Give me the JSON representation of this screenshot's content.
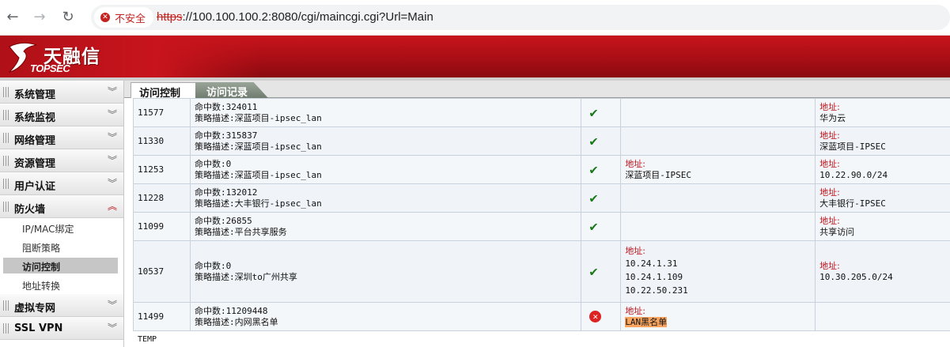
{
  "browser": {
    "security_label": "不安全",
    "url_proto": "https",
    "url_rest": "://100.100.100.2:8080/cgi/maincgi.cgi?Url=Main"
  },
  "brand": {
    "name_cn": "天融信",
    "name_en": "TOPSEC",
    "color": "#c8141c"
  },
  "sidebar": {
    "menus": [
      {
        "label": "系统管理",
        "expanded": false
      },
      {
        "label": "系统监视",
        "expanded": false
      },
      {
        "label": "网络管理",
        "expanded": false
      },
      {
        "label": "资源管理",
        "expanded": false
      },
      {
        "label": "用户认证",
        "expanded": false
      },
      {
        "label": "防火墙",
        "expanded": true
      },
      {
        "label": "虚拟专网",
        "expanded": false
      },
      {
        "label": "SSL VPN",
        "expanded": false
      }
    ],
    "firewall_items": [
      {
        "label": "IP/MAC绑定"
      },
      {
        "label": "阻断策略"
      },
      {
        "label": "访问控制",
        "active": true
      },
      {
        "label": "地址转换"
      }
    ]
  },
  "tabs": [
    {
      "label": "访问控制",
      "active": true
    },
    {
      "label": "访问记录",
      "active": false
    }
  ],
  "rows": [
    {
      "id": "11577",
      "hits": "命中数:324011",
      "desc": "策略描述:深蓝项目-ipsec_lan",
      "status": "enabled",
      "src_label": "",
      "src": [],
      "dst_label": "地址:",
      "dst": [
        "华为云"
      ]
    },
    {
      "id": "11330",
      "hits": "命中数:315837",
      "desc": "策略描述:深蓝项目-ipsec_lan",
      "status": "enabled",
      "src_label": "",
      "src": [],
      "dst_label": "地址:",
      "dst": [
        "深蓝项目-IPSEC"
      ]
    },
    {
      "id": "11253",
      "hits": "命中数:0",
      "desc": "策略描述:深蓝项目-ipsec_lan",
      "status": "enabled",
      "src_label": "地址:",
      "src": [
        "深蓝项目-IPSEC"
      ],
      "dst_label": "地址:",
      "dst": [
        "10.22.90.0/24"
      ]
    },
    {
      "id": "11228",
      "hits": "命中数:132012",
      "desc": "策略描述:大丰银行-ipsec_lan",
      "status": "enabled",
      "src_label": "",
      "src": [],
      "dst_label": "地址:",
      "dst": [
        "大丰银行-IPSEC"
      ]
    },
    {
      "id": "11099",
      "hits": "命中数:26855",
      "desc": "策略描述:平台共享服务",
      "status": "enabled",
      "src_label": "",
      "src": [],
      "dst_label": "地址:",
      "dst": [
        "共享访问"
      ]
    },
    {
      "id": "10537",
      "hits": "命中数:0",
      "desc": "策略描述:深圳to广州共享",
      "status": "enabled",
      "src_label": "地址:",
      "src": [
        "10.24.1.31",
        "10.24.1.109",
        "10.22.50.231"
      ],
      "dst_label": "地址:",
      "dst": [
        "10.30.205.0/24"
      ]
    },
    {
      "id": "11499",
      "hits": "命中数:11209448",
      "desc": "策略描述:内网黑名单",
      "status": "disabled",
      "src_label": "地址:",
      "src": [
        "LAN黑名单"
      ],
      "dst_label": "",
      "dst": []
    }
  ],
  "footer_text": "TEMP",
  "icons": {
    "enabled": "check-icon",
    "disabled": "x-circle-icon",
    "expand": "chevron-double-down-icon",
    "collapse": "chevron-double-up-icon"
  }
}
